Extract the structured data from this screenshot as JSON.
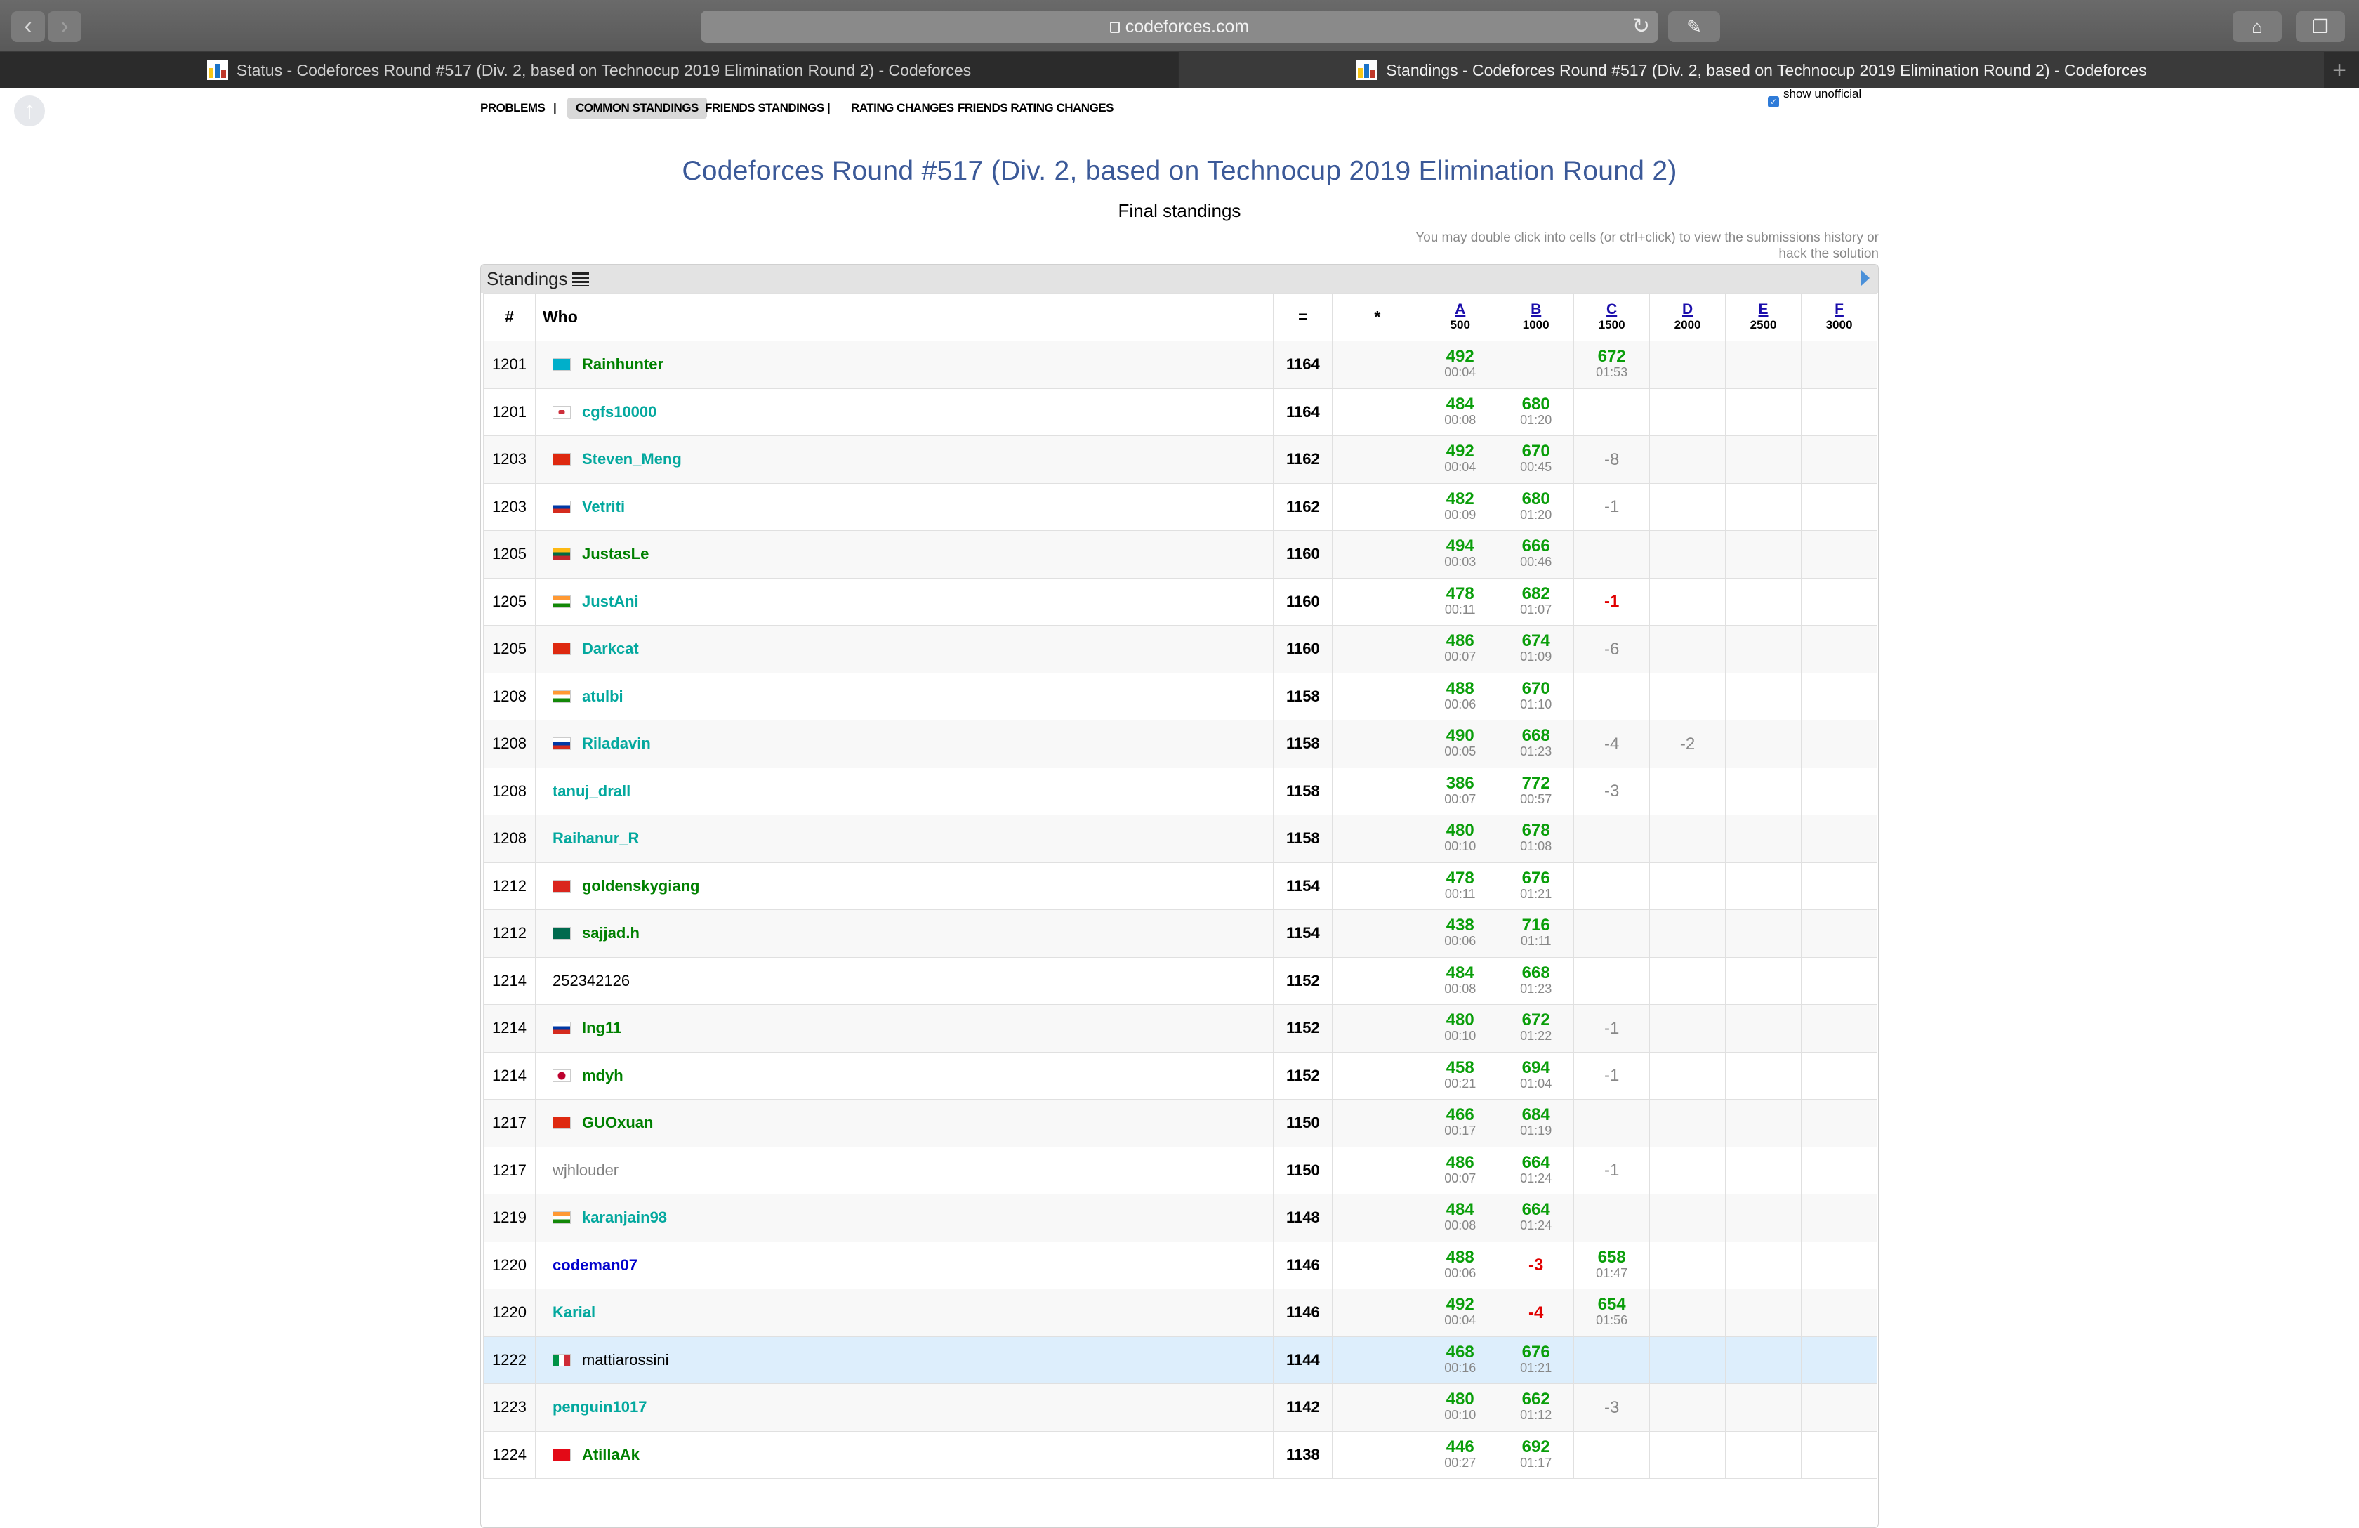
{
  "browser": {
    "url": "codeforces.com",
    "tabs": [
      {
        "title": "Status - Codeforces Round #517 (Div. 2, based on Technocup 2019 Elimination Round 2) - Codeforces",
        "active": false
      },
      {
        "title": "Standings - Codeforces Round #517 (Div. 2, based on Technocup 2019 Elimination Round 2) - Codeforces",
        "active": true
      }
    ]
  },
  "submenu": {
    "problems": "PROBLEMS",
    "sep": "|",
    "common": "COMMON STANDINGS",
    "friends": "FRIENDS STANDINGS",
    "rating": "RATING CHANGES",
    "friends_rating": "FRIENDS RATING CHANGES",
    "show_unofficial": "show unofficial"
  },
  "contest": {
    "title": "Codeforces Round #517 (Div. 2, based on Technocup 2019 Elimination Round 2)",
    "subtitle": "Final standings",
    "hint": "You may double click into cells (or ctrl+click) to view the submissions history or hack the solution"
  },
  "standings": {
    "label": "Standings",
    "columns": {
      "rank": "#",
      "who": "Who",
      "points": "=",
      "penalty": "*"
    },
    "problems": [
      {
        "letter": "A",
        "score": "500"
      },
      {
        "letter": "B",
        "score": "1000"
      },
      {
        "letter": "C",
        "score": "1500"
      },
      {
        "letter": "D",
        "score": "2000"
      },
      {
        "letter": "E",
        "score": "2500"
      },
      {
        "letter": "F",
        "score": "3000"
      }
    ],
    "rows": [
      {
        "rank": "1201",
        "who": "Rainhunter",
        "color": "green",
        "flag": "kz",
        "points": "1164",
        "cells": [
          [
            "492",
            "00:04"
          ],
          null,
          [
            "672",
            "01:53"
          ],
          null,
          null,
          null
        ]
      },
      {
        "rank": "1201",
        "who": "cgfs10000",
        "color": "cyan",
        "flag": "kr",
        "points": "1164",
        "cells": [
          [
            "484",
            "00:08"
          ],
          [
            "680",
            "01:20"
          ],
          null,
          null,
          null,
          null
        ]
      },
      {
        "rank": "1203",
        "who": "Steven_Meng",
        "color": "cyan",
        "flag": "cn",
        "points": "1162",
        "cells": [
          [
            "492",
            "00:04"
          ],
          [
            "670",
            "00:45"
          ],
          "-8",
          null,
          null,
          null
        ]
      },
      {
        "rank": "1203",
        "who": "Vetriti",
        "color": "cyan",
        "flag": "ru",
        "points": "1162",
        "cells": [
          [
            "482",
            "00:09"
          ],
          [
            "680",
            "01:20"
          ],
          "-1",
          null,
          null,
          null
        ]
      },
      {
        "rank": "1205",
        "who": "JustasLe",
        "color": "green",
        "flag": "lt",
        "points": "1160",
        "cells": [
          [
            "494",
            "00:03"
          ],
          [
            "666",
            "00:46"
          ],
          null,
          null,
          null,
          null
        ]
      },
      {
        "rank": "1205",
        "who": "JustAni",
        "color": "cyan",
        "flag": "in",
        "points": "1160",
        "cells": [
          [
            "478",
            "00:11"
          ],
          [
            "682",
            "01:07"
          ],
          "!-1",
          null,
          null,
          null
        ]
      },
      {
        "rank": "1205",
        "who": "Darkcat",
        "color": "cyan",
        "flag": "cn",
        "points": "1160",
        "cells": [
          [
            "486",
            "00:07"
          ],
          [
            "674",
            "01:09"
          ],
          "-6",
          null,
          null,
          null
        ]
      },
      {
        "rank": "1208",
        "who": "atulbi",
        "color": "cyan",
        "flag": "in",
        "points": "1158",
        "cells": [
          [
            "488",
            "00:06"
          ],
          [
            "670",
            "01:10"
          ],
          null,
          null,
          null,
          null
        ]
      },
      {
        "rank": "1208",
        "who": "Riladavin",
        "color": "cyan",
        "flag": "ru",
        "points": "1158",
        "cells": [
          [
            "490",
            "00:05"
          ],
          [
            "668",
            "01:23"
          ],
          "-4",
          "-2",
          null,
          null
        ]
      },
      {
        "rank": "1208",
        "who": "tanuj_drall",
        "color": "cyan",
        "flag": "",
        "points": "1158",
        "cells": [
          [
            "386",
            "00:07"
          ],
          [
            "772",
            "00:57"
          ],
          "-3",
          null,
          null,
          null
        ]
      },
      {
        "rank": "1208",
        "who": "Raihanur_R",
        "color": "cyan",
        "flag": "",
        "points": "1158",
        "cells": [
          [
            "480",
            "00:10"
          ],
          [
            "678",
            "01:08"
          ],
          null,
          null,
          null,
          null
        ]
      },
      {
        "rank": "1212",
        "who": "goldenskygiang",
        "color": "green",
        "flag": "vn",
        "points": "1154",
        "cells": [
          [
            "478",
            "00:11"
          ],
          [
            "676",
            "01:21"
          ],
          null,
          null,
          null,
          null
        ]
      },
      {
        "rank": "1212",
        "who": "sajjad.h",
        "color": "green",
        "flag": "bd",
        "points": "1154",
        "cells": [
          [
            "438",
            "00:06"
          ],
          [
            "716",
            "01:11"
          ],
          null,
          null,
          null,
          null
        ]
      },
      {
        "rank": "1214",
        "who": "252342126",
        "color": "black",
        "flag": "",
        "points": "1152",
        "cells": [
          [
            "484",
            "00:08"
          ],
          [
            "668",
            "01:23"
          ],
          null,
          null,
          null,
          null
        ]
      },
      {
        "rank": "1214",
        "who": "lng11",
        "color": "green",
        "flag": "ru",
        "points": "1152",
        "cells": [
          [
            "480",
            "00:10"
          ],
          [
            "672",
            "01:22"
          ],
          "-1",
          null,
          null,
          null
        ]
      },
      {
        "rank": "1214",
        "who": "mdyh",
        "color": "green",
        "flag": "jp",
        "points": "1152",
        "cells": [
          [
            "458",
            "00:21"
          ],
          [
            "694",
            "01:04"
          ],
          "-1",
          null,
          null,
          null
        ]
      },
      {
        "rank": "1217",
        "who": "GUOxuan",
        "color": "green",
        "flag": "cn",
        "points": "1150",
        "cells": [
          [
            "466",
            "00:17"
          ],
          [
            "684",
            "01:19"
          ],
          null,
          null,
          null,
          null
        ]
      },
      {
        "rank": "1217",
        "who": "wjhlouder",
        "color": "gray",
        "flag": "",
        "points": "1150",
        "cells": [
          [
            "486",
            "00:07"
          ],
          [
            "664",
            "01:24"
          ],
          "-1",
          null,
          null,
          null
        ]
      },
      {
        "rank": "1219",
        "who": "karanjain98",
        "color": "cyan",
        "flag": "in",
        "points": "1148",
        "cells": [
          [
            "484",
            "00:08"
          ],
          [
            "664",
            "01:24"
          ],
          null,
          null,
          null,
          null
        ]
      },
      {
        "rank": "1220",
        "who": "codeman07",
        "color": "blue",
        "flag": "",
        "points": "1146",
        "cells": [
          [
            "488",
            "00:06"
          ],
          "!-3",
          [
            "658",
            "01:47"
          ],
          null,
          null,
          null
        ]
      },
      {
        "rank": "1220",
        "who": "Karial",
        "color": "cyan",
        "flag": "",
        "points": "1146",
        "cells": [
          [
            "492",
            "00:04"
          ],
          "!-4",
          [
            "654",
            "01:56"
          ],
          null,
          null,
          null
        ]
      },
      {
        "rank": "1222",
        "who": "mattiarossini",
        "color": "black",
        "flag": "it",
        "points": "1144",
        "highlight": true,
        "cells": [
          [
            "468",
            "00:16"
          ],
          [
            "676",
            "01:21"
          ],
          null,
          null,
          null,
          null
        ]
      },
      {
        "rank": "1223",
        "who": "penguin1017",
        "color": "cyan",
        "flag": "",
        "points": "1142",
        "cells": [
          [
            "480",
            "00:10"
          ],
          [
            "662",
            "01:12"
          ],
          "-3",
          null,
          null,
          null
        ]
      },
      {
        "rank": "1224",
        "who": "AtillaAk",
        "color": "green",
        "flag": "tr",
        "points": "1138",
        "cells": [
          [
            "446",
            "00:27"
          ],
          [
            "692",
            "01:17"
          ],
          null,
          null,
          null,
          null
        ]
      }
    ]
  }
}
